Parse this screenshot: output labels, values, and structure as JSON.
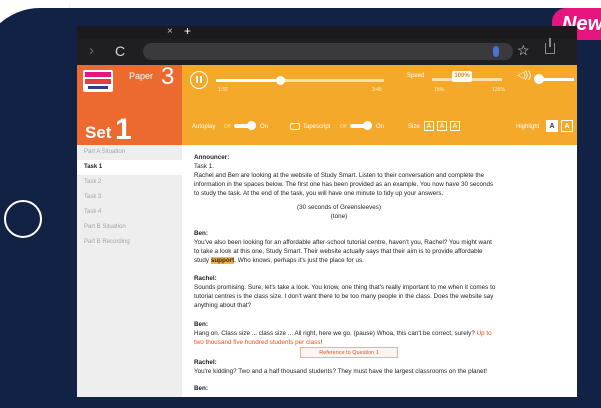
{
  "badge": {
    "text": "New"
  },
  "browser": {
    "tab_close": "×",
    "tab_new": "+",
    "back": "›",
    "reload": "C",
    "star": "☆"
  },
  "app": {
    "paper_label": "Paper",
    "paper_number": "3",
    "set_label": "Set",
    "set_number": "1"
  },
  "player": {
    "time_current": "1:32",
    "time_total": "3:45",
    "progress": 0.38,
    "speed_label": "Speed",
    "speed_value": "100%",
    "speed_min": "75%",
    "speed_max": "125%",
    "autoplay_label": "Autoplay",
    "autoplay_off": "Off",
    "autoplay_on": "On",
    "tapescript_label": "Tapescript",
    "tapescript_off": "Off",
    "tapescript_on": "On",
    "size_label": "Size",
    "size_options": [
      "A",
      "A",
      "A"
    ],
    "highlight_label": "Highlight",
    "highlight_options": [
      "A",
      "A"
    ]
  },
  "sidebar": {
    "items": [
      {
        "label": "Part A Situation"
      },
      {
        "label": "Task 1"
      },
      {
        "label": "Task 2"
      },
      {
        "label": "Task 3"
      },
      {
        "label": "Task 4"
      },
      {
        "label": "Part B Situation"
      },
      {
        "label": "Part B Recording"
      }
    ],
    "active_index": 1
  },
  "script": {
    "announcer": "Announcer:",
    "task": "Task 1.",
    "intro1": "Rachel and Ben are looking at the website of Study Smart. Listen to their conversation and complete the",
    "intro2": "information in the spaces below. The first one has been provided as an example. You now have 30 seconds",
    "intro3": "to study the task. At the end of the task, you will have one minute to tidy up your answers.",
    "music": "(30 seconds of Greensleeves)",
    "tone": "(tone)",
    "ben1": "Ben:",
    "ben1_l1": "You've also been looking for an affordable after-school tutorial centre, haven't you, Rachel? You might want",
    "ben1_l2": "to take a look at this one, Study Smart. Their website actually says that their aim is to provide affordable",
    "ben1_l3a": "study ",
    "ben1_l3_hl": "support",
    "ben1_l3b": ". Who knows, perhaps it's just the place for us.",
    "rachel1": "Rachel:",
    "rachel1_l1": "Sounds promising. Sure, let's take a look. You know, one thing that's really important to me when it comes to",
    "rachel1_l2": "tutorial centres is the class size. I don't want there to be too many people in the class. Does the website say",
    "rachel1_l3": "anything about that?",
    "ben2": "Ben:",
    "ben2_l1a": "Hang on. Class size ... class size ... All right, here we go. (pause) Whoa, this can't be correct, surely? ",
    "ben2_l1_red": "Up to",
    "ben2_l2_red": "two thousand five hundred students per class",
    "ben2_l2b": "!",
    "ref_label": "Reference to Question 1",
    "rachel2": "Rachel:",
    "rachel2_l1": "You're kidding? Two and a half thousand students? They must have the largest classrooms on the planet!",
    "ben3": "Ben:"
  }
}
